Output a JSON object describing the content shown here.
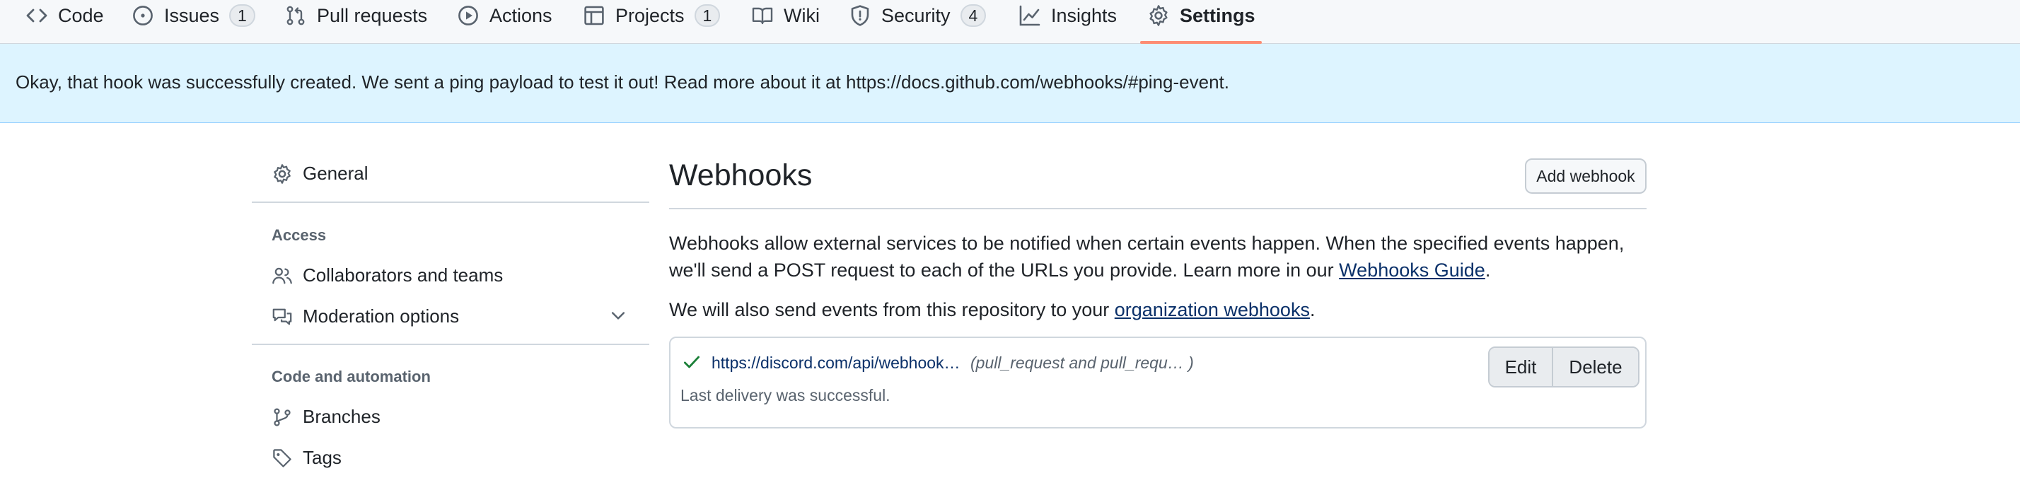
{
  "nav": {
    "tabs": [
      {
        "label": "Code",
        "icon": "code-icon"
      },
      {
        "label": "Issues",
        "icon": "issue-opened-icon",
        "count": "1"
      },
      {
        "label": "Pull requests",
        "icon": "git-pull-request-icon"
      },
      {
        "label": "Actions",
        "icon": "play-icon"
      },
      {
        "label": "Projects",
        "icon": "table-icon",
        "count": "1"
      },
      {
        "label": "Wiki",
        "icon": "book-icon"
      },
      {
        "label": "Security",
        "icon": "shield-icon",
        "count": "4"
      },
      {
        "label": "Insights",
        "icon": "graph-icon"
      },
      {
        "label": "Settings",
        "icon": "gear-icon",
        "active": true
      }
    ],
    "active_underline_color": "#fd8c73"
  },
  "flash": {
    "message": "Okay, that hook was successfully created. We sent a ping payload to test it out! Read more about it at https://docs.github.com/webhooks/#ping-event.",
    "background": "#ddf4ff"
  },
  "sidebar": {
    "general": "General",
    "access_heading": "Access",
    "collaborators": "Collaborators and teams",
    "moderation": "Moderation options",
    "code_heading": "Code and automation",
    "branches": "Branches",
    "tags": "Tags"
  },
  "main": {
    "title": "Webhooks",
    "add_button": "Add webhook",
    "description_pre": "Webhooks allow external services to be notified when certain events happen. When the specified events happen, we'll send a POST request to each of the URLs you provide. Learn more in our ",
    "description_link": "Webhooks Guide",
    "description_post": ".",
    "org_pre": "We will also send events from this repository to your ",
    "org_link": "organization webhooks",
    "org_post": ".",
    "hook": {
      "url": "https://discord.com/api/webhook…",
      "events": "(pull_request and pull_requ… )",
      "status": "Last delivery was successful.",
      "edit_label": "Edit",
      "delete_label": "Delete",
      "status_color": "#1a7f37"
    }
  }
}
